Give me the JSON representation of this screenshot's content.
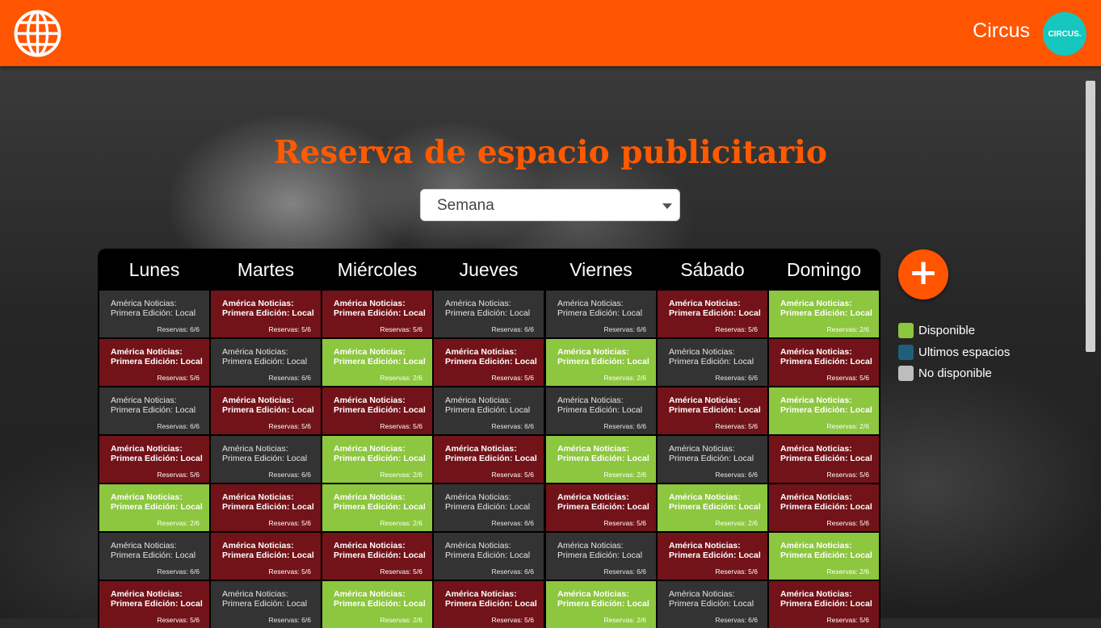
{
  "header": {
    "user_name": "Circus",
    "avatar_text": "CIRCUS."
  },
  "page": {
    "title": "Reserva de espacio publicitario"
  },
  "view_select": {
    "value": "Semana"
  },
  "colors": {
    "accent": "#ff5500",
    "disponible": "#8dc63f",
    "ultimos": "#1f5f7a",
    "no_disponible": "#bdbdbd",
    "reserved": "#82161c"
  },
  "days": [
    "Lunes",
    "Martes",
    "Miércoles",
    "Jueves",
    "Viernes",
    "Sábado",
    "Domingo"
  ],
  "slot_line1": "América Noticias:",
  "slot_line2": "Primera Edición: Local",
  "grid": [
    [
      {
        "s": "dark",
        "r": "Reservas: 6/6"
      },
      {
        "s": "red",
        "r": "Reservas: 5/6"
      },
      {
        "s": "red",
        "r": "Reservas: 5/6"
      },
      {
        "s": "dark",
        "r": "Reservas: 6/6"
      },
      {
        "s": "dark",
        "r": "Reservas: 6/6"
      },
      {
        "s": "red",
        "r": "Reservas: 5/6"
      },
      {
        "s": "green",
        "r": "Reservas: 2/6"
      }
    ],
    [
      {
        "s": "red",
        "r": "Reservas: 5/6"
      },
      {
        "s": "dark",
        "r": "Reservas: 6/6"
      },
      {
        "s": "green",
        "r": "Reservas: 2/6"
      },
      {
        "s": "red",
        "r": "Reservas: 5/6"
      },
      {
        "s": "green",
        "r": "Reservas: 2/6"
      },
      {
        "s": "dark",
        "r": "Reservas: 6/6"
      },
      {
        "s": "red",
        "r": "Reservas: 5/6"
      }
    ],
    [
      {
        "s": "dark",
        "r": "Reservas: 6/6"
      },
      {
        "s": "red",
        "r": "Reservas: 5/6"
      },
      {
        "s": "red",
        "r": "Reservas: 5/6"
      },
      {
        "s": "dark",
        "r": "Reservas: 6/6"
      },
      {
        "s": "dark",
        "r": "Reservas: 6/6"
      },
      {
        "s": "red",
        "r": "Reservas: 5/6"
      },
      {
        "s": "green",
        "r": "Reservas: 2/6"
      }
    ],
    [
      {
        "s": "red",
        "r": "Reservas: 5/6"
      },
      {
        "s": "dark",
        "r": "Reservas: 6/6"
      },
      {
        "s": "green",
        "r": "Reservas: 2/6"
      },
      {
        "s": "red",
        "r": "Reservas: 5/6"
      },
      {
        "s": "green",
        "r": "Reservas: 2/6"
      },
      {
        "s": "dark",
        "r": "Reservas: 6/6"
      },
      {
        "s": "red",
        "r": "Reservas: 5/6"
      }
    ],
    [
      {
        "s": "green",
        "r": "Reservas: 2/6"
      },
      {
        "s": "red",
        "r": "Reservas: 5/6"
      },
      {
        "s": "green",
        "r": "Reservas: 2/6"
      },
      {
        "s": "dark",
        "r": "Reservas: 6/6"
      },
      {
        "s": "red",
        "r": "Reservas: 5/6"
      },
      {
        "s": "green",
        "r": "Reservas: 2/6"
      },
      {
        "s": "red",
        "r": "Reservas: 5/6"
      }
    ],
    [
      {
        "s": "dark",
        "r": "Reservas: 6/6"
      },
      {
        "s": "red",
        "r": "Reservas: 5/6"
      },
      {
        "s": "red",
        "r": "Reservas: 5/6"
      },
      {
        "s": "dark",
        "r": "Reservas: 6/6"
      },
      {
        "s": "dark",
        "r": "Reservas: 6/6"
      },
      {
        "s": "red",
        "r": "Reservas: 5/6"
      },
      {
        "s": "green",
        "r": "Reservas: 2/6"
      }
    ],
    [
      {
        "s": "red",
        "r": "Reservas: 5/6"
      },
      {
        "s": "dark",
        "r": "Reservas: 6/6"
      },
      {
        "s": "green",
        "r": "Reservas: 2/6"
      },
      {
        "s": "red",
        "r": "Reservas: 5/6"
      },
      {
        "s": "green",
        "r": "Reservas: 2/6"
      },
      {
        "s": "dark",
        "r": "Reservas: 6/6"
      },
      {
        "s": "red",
        "r": "Reservas: 5/6"
      }
    ]
  ],
  "add_button": {
    "label": "+"
  },
  "legend": [
    {
      "label": "Disponible",
      "color": "#8dc63f"
    },
    {
      "label": "Ultimos espacios",
      "color": "#1f5f7a"
    },
    {
      "label": "No disponible",
      "color": "#bdbdbd"
    }
  ]
}
